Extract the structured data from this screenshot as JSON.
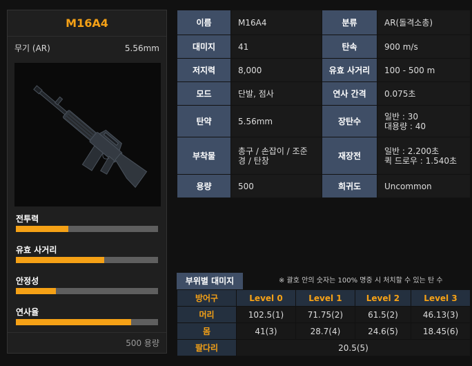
{
  "weapon": {
    "name": "M16A4",
    "type_label": "무기 (AR)",
    "caliber": "5.56mm",
    "ammo_footer": "500 용량"
  },
  "stats": [
    {
      "label": "전투력",
      "level": 0.37
    },
    {
      "label": "유효 사거리",
      "level": 0.62
    },
    {
      "label": "안정성",
      "level": 0.28
    },
    {
      "label": "연사율",
      "level": 0.81
    }
  ],
  "info": {
    "rows": [
      {
        "l1": "이름",
        "v1": "M16A4",
        "l2": "분류",
        "v2": "AR(돌격소총)"
      },
      {
        "l1": "대미지",
        "v1": "41",
        "l2": "탄속",
        "v2": "900 m/s"
      },
      {
        "l1": "저지력",
        "v1": "8,000",
        "l2": "유효 사거리",
        "v2": "100 - 500 m"
      },
      {
        "l1": "모드",
        "v1": "단발, 점사",
        "l2": "연사 간격",
        "v2": "0.075초"
      },
      {
        "l1": "탄약",
        "v1": "5.56mm",
        "l2": "장탄수",
        "v2a": "일반 : 30",
        "v2b": "대용량 : 40"
      },
      {
        "l1": "부착물",
        "v1a": "총구 / 손잡이 / 조준",
        "v1b": "경 / 탄창",
        "l2": "재장전",
        "v2a": "일반 : 2.200초",
        "v2b": "퀵 드로우 : 1.540초"
      },
      {
        "l1": "용량",
        "v1": "500",
        "l2": "희귀도",
        "v2": "Uncommon"
      }
    ]
  },
  "damage": {
    "tab_label": "부위별 대미지",
    "note": "※ 괄호 안의 숫자는 100% 명중 시 처치할 수 있는 탄 수",
    "headers": [
      "방어구",
      "Level 0",
      "Level 1",
      "Level 2",
      "Level 3"
    ],
    "rows": [
      {
        "part": "머리",
        "values": [
          "102.5(1)",
          "71.75(2)",
          "61.5(2)",
          "46.13(3)"
        ]
      },
      {
        "part": "몸",
        "values": [
          "41(3)",
          "28.7(4)",
          "24.6(5)",
          "18.45(6)"
        ]
      },
      {
        "part": "팔다리",
        "merged": "20.5(5)"
      }
    ]
  }
}
